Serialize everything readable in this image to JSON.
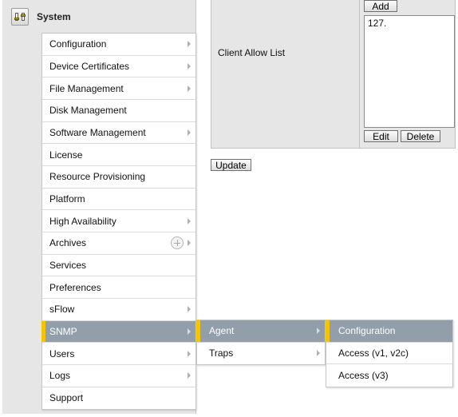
{
  "header": {
    "title": "System",
    "icon": "system-settings-icon"
  },
  "menu_primary": {
    "items": [
      {
        "label": "Configuration",
        "has_submenu": true
      },
      {
        "label": "Device Certificates",
        "has_submenu": true
      },
      {
        "label": "File Management",
        "has_submenu": true
      },
      {
        "label": "Disk Management",
        "has_submenu": false
      },
      {
        "label": "Software Management",
        "has_submenu": true
      },
      {
        "label": "License",
        "has_submenu": false
      },
      {
        "label": "Resource Provisioning",
        "has_submenu": false
      },
      {
        "label": "Platform",
        "has_submenu": false
      },
      {
        "label": "High Availability",
        "has_submenu": true
      },
      {
        "label": "Archives",
        "has_submenu": true
      },
      {
        "label": "Services",
        "has_submenu": false
      },
      {
        "label": "Preferences",
        "has_submenu": false
      },
      {
        "label": "sFlow",
        "has_submenu": true
      },
      {
        "label": "SNMP",
        "has_submenu": true,
        "active": true
      },
      {
        "label": "Users",
        "has_submenu": true
      },
      {
        "label": "Logs",
        "has_submenu": true
      },
      {
        "label": "Support",
        "has_submenu": false
      }
    ]
  },
  "menu_snmp": {
    "items": [
      {
        "label": "Agent",
        "has_submenu": true,
        "active": true
      },
      {
        "label": "Traps",
        "has_submenu": true
      }
    ]
  },
  "menu_agent": {
    "items": [
      {
        "label": "Configuration",
        "active": true
      },
      {
        "label": "Access (v1, v2c)"
      },
      {
        "label": "Access (v3)"
      }
    ]
  },
  "form": {
    "client_allow_list_label": "Client Allow List",
    "add_button": "Add",
    "list_entries": [
      "127."
    ],
    "edit_button": "Edit",
    "delete_button": "Delete",
    "update_button": "Update"
  },
  "colors": {
    "active_background": "#929fab",
    "active_indicator": "#f5c400",
    "panel_background": "#e6e6e6"
  }
}
